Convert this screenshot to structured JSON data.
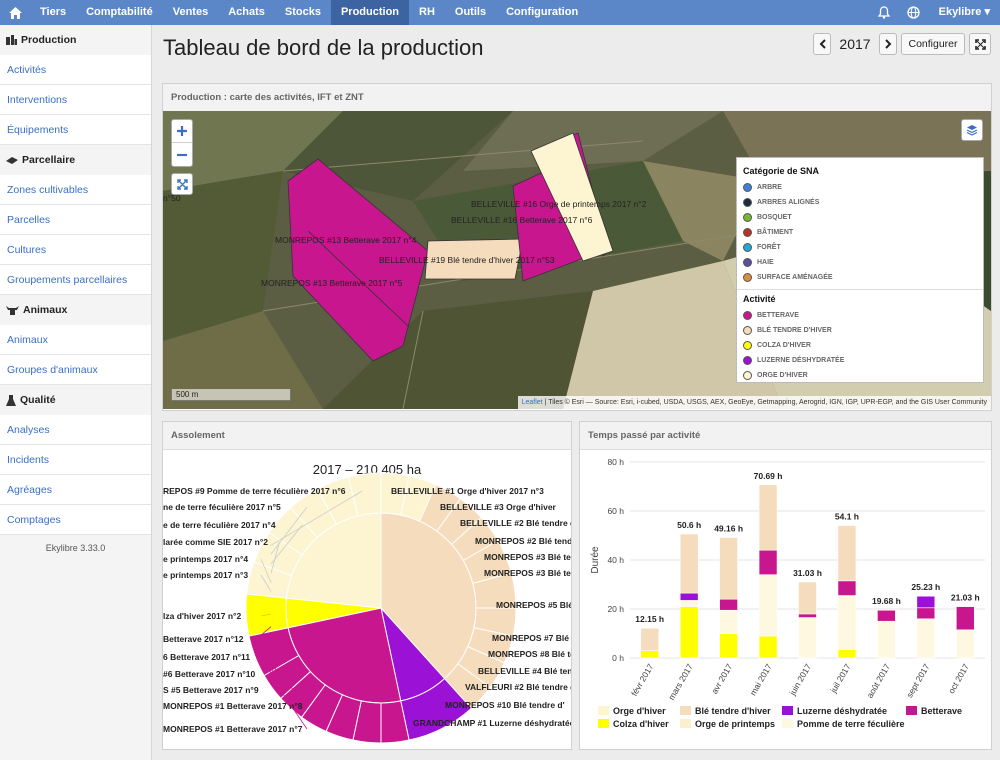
{
  "nav": {
    "items": [
      "Tiers",
      "Comptabilité",
      "Ventes",
      "Achats",
      "Stocks",
      "Production",
      "RH",
      "Outils",
      "Configuration"
    ],
    "active": "Production",
    "user": "Ekylibre ▾"
  },
  "sidebar": {
    "sections": [
      {
        "title": "Production",
        "icon": "production-icon",
        "items": [
          "Activités",
          "Interventions",
          "Équipements"
        ]
      },
      {
        "title": "Parcellaire",
        "icon": "map-icon",
        "items": [
          "Zones cultivables",
          "Parcelles",
          "Cultures",
          "Groupements parcellaires"
        ]
      },
      {
        "title": "Animaux",
        "icon": "cow-icon",
        "items": [
          "Animaux",
          "Groupes d'animaux"
        ]
      },
      {
        "title": "Qualité",
        "icon": "flask-icon",
        "items": [
          "Analyses",
          "Incidents",
          "Agréages",
          "Comptages"
        ]
      }
    ],
    "version": "Ekylibre 3.33.0"
  },
  "header": {
    "title": "Tableau de bord de la production",
    "year": "2017",
    "configure": "Configurer"
  },
  "map_panel": {
    "title": "Production : carte des activités, IFT et ZNT",
    "scale": "500 m",
    "attribution_link": "Leaflet",
    "attribution": " | Tiles © Esri — Source: Esri, i-cubed, USDA, USGS, AEX, GeoEye, Getmapping, Aerogrid, IGN, IGP, UPR-EGP, and the GIS User Community",
    "labels": [
      "BELLEVILLE #16 Orge de printemps 2017 n°2",
      "BELLEVILLE #16 Betterave 2017 n°6",
      "MONREPOS #13 Betterave 2017 n°4",
      "BELLEVILLE #19 Blé tendre d'hiver 2017 n°53",
      "MONREPOS #13 Betterave 2017 n°5",
      "n°50"
    ],
    "legend": {
      "sna_title": "Catégorie de SNA",
      "sna": [
        {
          "label": "Arbre",
          "color": "#3b82d6"
        },
        {
          "label": "Arbres alignés",
          "color": "#1c2c40"
        },
        {
          "label": "Bosquet",
          "color": "#7ab52e"
        },
        {
          "label": "Bâtiment",
          "color": "#b83227"
        },
        {
          "label": "Forêt",
          "color": "#22a7d6"
        },
        {
          "label": "Haie",
          "color": "#5a4f9c"
        },
        {
          "label": "Surface aménagée",
          "color": "#e08a3c"
        }
      ],
      "act_title": "Activité",
      "activities": [
        {
          "label": "Betterave",
          "color": "#c8168e"
        },
        {
          "label": "Blé tendre d'hiver",
          "color": "#f5dcbc"
        },
        {
          "label": "Colza d'hiver",
          "color": "#ffff00"
        },
        {
          "label": "Luzerne déshydratée",
          "color": "#9b12d6"
        },
        {
          "label": "Orge d'hiver",
          "color": "#fdf4d2"
        }
      ]
    }
  },
  "assolement": {
    "title": "Assolement",
    "chart_title": "2017 – 210,405 ha",
    "labels_left": [
      "REPOS #9 Pomme de terre féculière 2017 n°6",
      "ne de terre féculière 2017 n°5",
      "e de terre féculière 2017 n°4",
      "larée comme SIE 2017 n°2",
      "e printemps 2017 n°4",
      "e printemps 2017 n°3",
      "lza d'hiver 2017 n°2",
      "Betterave 2017 n°12",
      "6 Betterave 2017 n°11",
      "#6 Betterave 2017 n°10",
      "S #5 Betterave 2017 n°9",
      "MONREPOS #1 Betterave 2017 n°8",
      "MONREPOS #1 Betterave 2017 n°7"
    ],
    "labels_right": [
      "BELLEVILLE #1 Orge d'hiver 2017 n°3",
      "BELLEVILLE #3 Orge d'hiver",
      "BELLEVILLE #2 Blé tendre d",
      "MONREPOS #2 Blé tendre",
      "MONREPOS #3 Blé tend",
      "MONREPOS #3 Blé tendr",
      "MONREPOS #5 Blé",
      "MONREPOS #7 Blé t",
      "MONREPOS #8 Blé ten",
      "BELLEVILLE #4 Blé tendr",
      "VALFLEURI #2 Blé tendre d'",
      "MONREPOS #10 Blé tendre d'",
      "GRANDCHAMP #1 Luzerne déshydratée"
    ]
  },
  "time_panel": {
    "title": "Temps passé par activité"
  },
  "chart_data": {
    "type": "bar",
    "stacked": true,
    "ylabel": "Durée",
    "ylim": [
      0,
      80
    ],
    "y_ticks": [
      "0 h",
      "20 h",
      "40 h",
      "60 h",
      "80 h"
    ],
    "categories": [
      "févr 2017",
      "mars 2017",
      "avr 2017",
      "mai 2017",
      "juin 2017",
      "juil 2017",
      "août 2017",
      "sept 2017",
      "oct 2017"
    ],
    "totals": [
      "12.15 h",
      "50.6 h",
      "49.16 h",
      "70.69 h",
      "31.03 h",
      "54.1 h",
      "19.68 h",
      "25.23 h",
      "21.03 h"
    ],
    "series": [
      {
        "name": "Orge d'hiver",
        "color": "#fdf4d2",
        "values": [
          0,
          0,
          0,
          0,
          0,
          0,
          0,
          0,
          0
        ]
      },
      {
        "name": "Colza d'hiver",
        "color": "#ffff00",
        "values": [
          3,
          21,
          10,
          9,
          0,
          3.5,
          0,
          0,
          0
        ]
      },
      {
        "name": "Pomme de terre féculière",
        "color": "#fff8e0",
        "values": [
          0,
          2.5,
          9.5,
          25,
          16.5,
          22,
          15,
          16,
          11.5
        ]
      },
      {
        "name": "Orge de printemps",
        "color": "#fcf0cc",
        "values": [
          0,
          0,
          0,
          0,
          0,
          0,
          0,
          0,
          0
        ]
      },
      {
        "name": "Betterave",
        "color": "#c8168e",
        "values": [
          0,
          0,
          4.5,
          10,
          1.5,
          6,
          4.5,
          4.5,
          9.5
        ]
      },
      {
        "name": "Luzerne déshydratée",
        "color": "#9b12d6",
        "values": [
          0,
          3,
          0,
          0,
          0,
          0,
          0,
          4.73,
          0
        ]
      },
      {
        "name": "Blé tendre d'hiver",
        "color": "#f5dcbc",
        "values": [
          9.15,
          24.1,
          25.16,
          26.69,
          13.03,
          22.6,
          0.18,
          0,
          0.03
        ]
      }
    ],
    "legend": [
      "Orge d'hiver",
      "Blé tendre d'hiver",
      "Luzerne déshydratée",
      "Betterave",
      "Colza d'hiver",
      "Orge de printemps",
      "Pomme de terre féculière"
    ]
  }
}
